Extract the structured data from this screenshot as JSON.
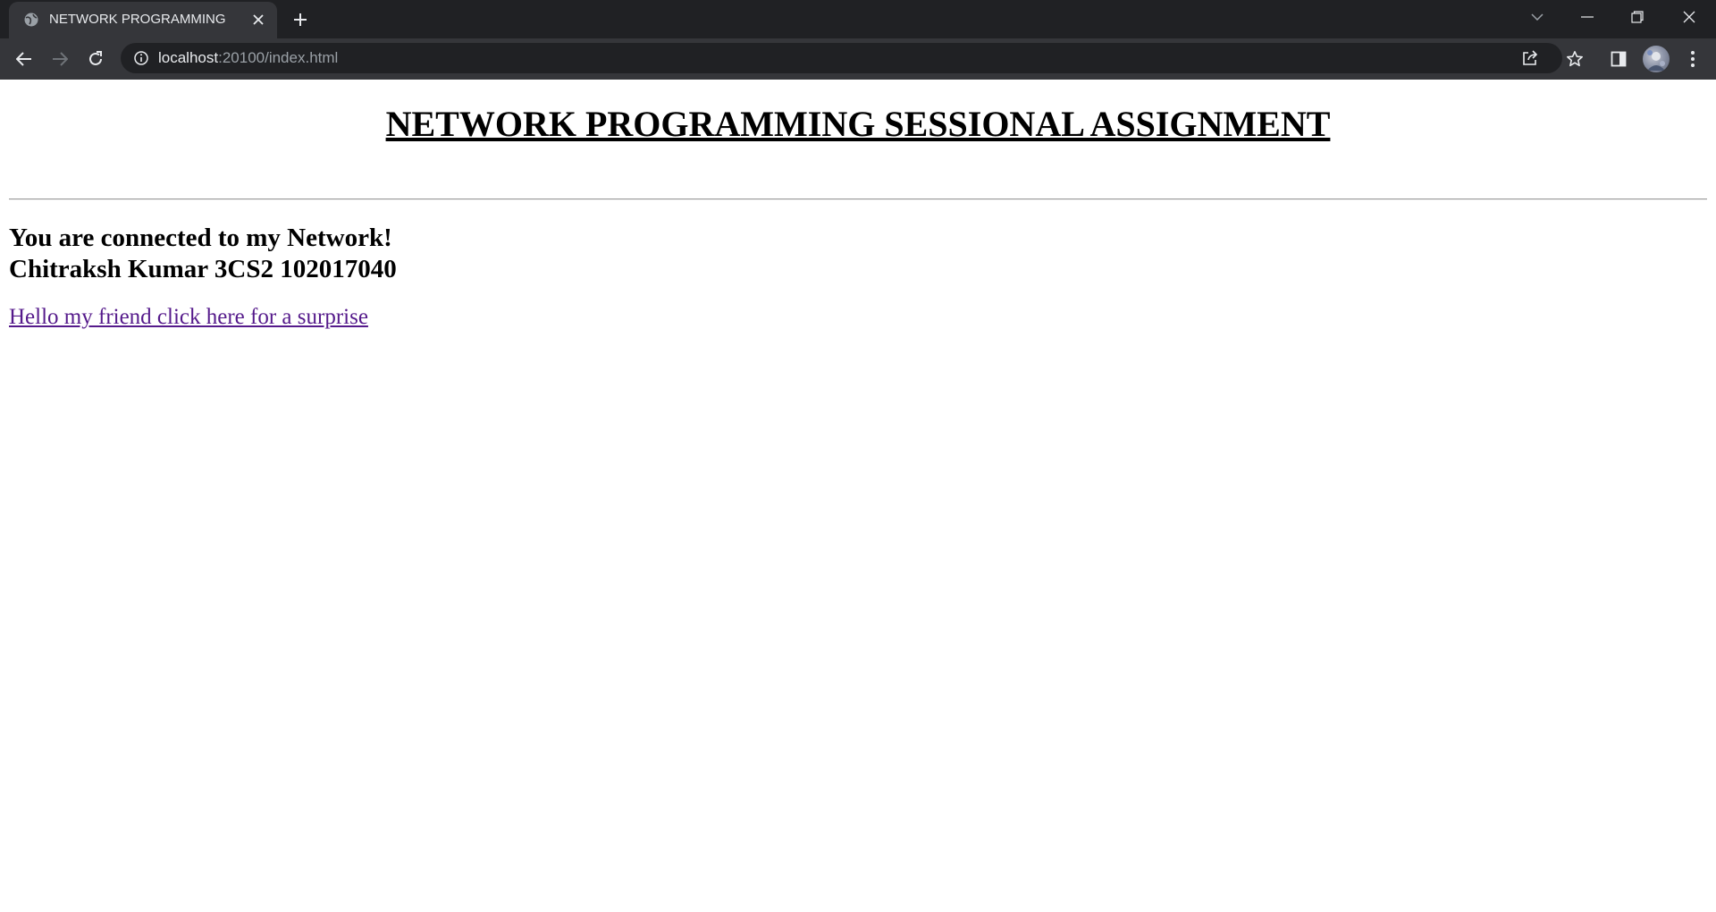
{
  "browser": {
    "tab": {
      "title": "NETWORK PROGRAMMING",
      "favicon": "globe-icon"
    },
    "address_bar": {
      "host": "localhost",
      "path": ":20100/index.html"
    },
    "icons": {
      "back": "arrow-left-icon",
      "forward": "arrow-right-icon",
      "reload": "reload-icon",
      "info": "info-icon",
      "share": "share-icon",
      "bookmark": "star-icon",
      "side_panel": "side-panel-icon",
      "menu": "kebab-menu-icon"
    }
  },
  "page": {
    "title": "NETWORK PROGRAMMING SESSIONAL ASSIGNMENT",
    "message_line1": "You are connected to my Network!",
    "message_line2": "Chitraksh Kumar 3CS2 102017040",
    "link_text": "Hello my friend click here for a surprise",
    "link_color": "#551a8b"
  },
  "colors": {
    "chrome_dark": "#202124",
    "chrome_toolbar": "#35363a",
    "chrome_text": "#e8eaed",
    "chrome_muted": "#9aa0a6"
  }
}
